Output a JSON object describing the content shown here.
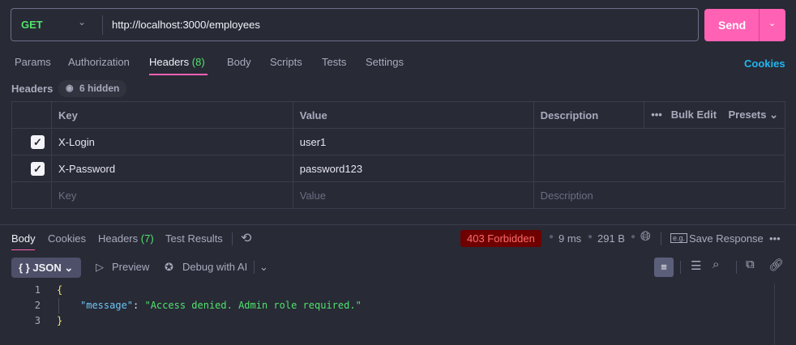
{
  "request": {
    "method": "GET",
    "url": "http://localhost:3000/employees",
    "send_label": "Send"
  },
  "tabs": [
    {
      "label": "Params"
    },
    {
      "label": "Authorization"
    },
    {
      "label": "Headers",
      "count": "(8)"
    },
    {
      "label": "Body"
    },
    {
      "label": "Scripts"
    },
    {
      "label": "Tests"
    },
    {
      "label": "Settings"
    }
  ],
  "cookies_link": "Cookies",
  "headers_section": {
    "label": "Headers",
    "hidden_badge": "6 hidden",
    "columns": [
      "Key",
      "Value",
      "Description"
    ],
    "bulk_edit": "Bulk Edit",
    "presets": "Presets",
    "rows": [
      {
        "checked": true,
        "key": "X-Login",
        "value": "user1",
        "description": ""
      },
      {
        "checked": true,
        "key": "X-Password",
        "value": "password123",
        "description": ""
      }
    ],
    "placeholders": {
      "key": "Key",
      "value": "Value",
      "description": "Description"
    }
  },
  "response": {
    "tabs": [
      {
        "label": "Body"
      },
      {
        "label": "Cookies"
      },
      {
        "label": "Headers",
        "count": "(7)"
      },
      {
        "label": "Test Results"
      }
    ],
    "status": "403 Forbidden",
    "status_color": "#6e0000",
    "time": "9 ms",
    "size": "291 B",
    "save_response": "Save Response",
    "format": "JSON",
    "preview": "Preview",
    "debug": "Debug with AI",
    "code": {
      "lines": [
        "1",
        "2",
        "3"
      ],
      "open": "{",
      "key": "\"message\"",
      "colon": ": ",
      "value": "\"Access denied. Admin role required.\"",
      "close": "}"
    }
  },
  "colors": {
    "accent": "#ff62b4",
    "method": "#50e36b",
    "link": "#1fb7f0",
    "background": "#282a36"
  }
}
